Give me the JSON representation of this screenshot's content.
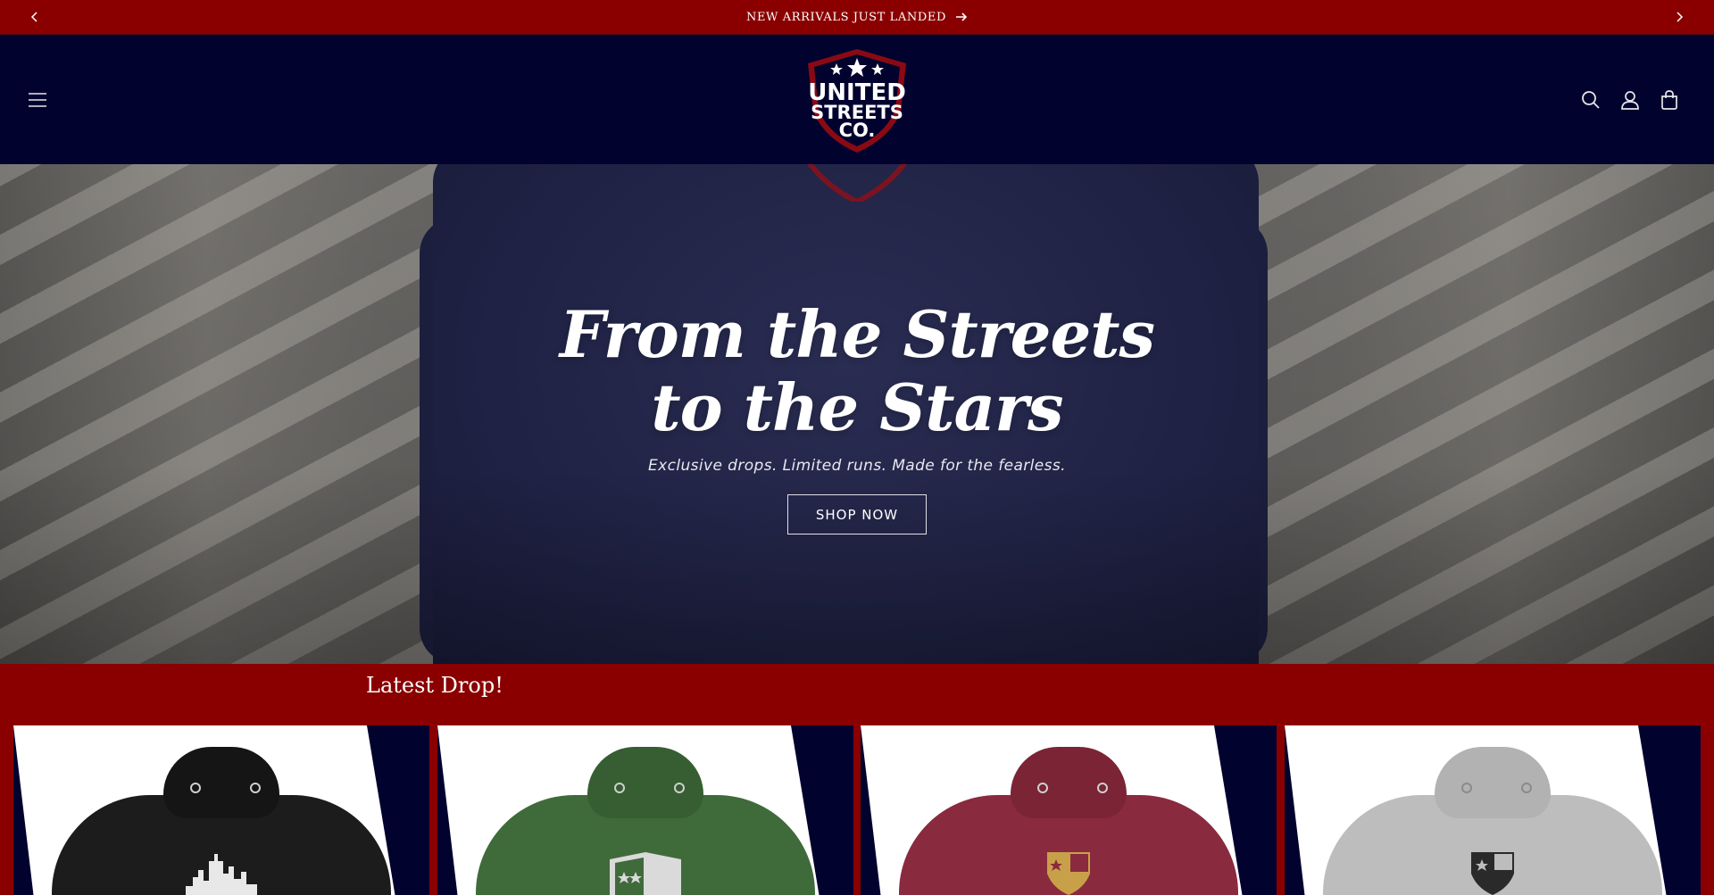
{
  "announcement": {
    "text": "NEW ARRIVALS JUST LANDED",
    "prev_icon": "chevron-left-icon",
    "next_icon": "chevron-right-icon",
    "link_icon": "arrow-right-icon"
  },
  "header": {
    "logo": {
      "line1": "UNITED",
      "line2": "STREETS",
      "line3": "CO."
    },
    "menu_icon": "hamburger-icon",
    "search_icon": "search-icon",
    "account_icon": "user-icon",
    "cart_icon": "cart-icon"
  },
  "hero": {
    "title": "From the Streets to the Stars",
    "subtitle": "Exclusive drops. Limited runs. Made for the fearless.",
    "button_label": "SHOP NOW"
  },
  "latest_drop": {
    "title": "Latest Drop!",
    "products": [
      {
        "color_name": "black",
        "hoodie_color": "#1c1c1c",
        "print": "city-skyline-graphic"
      },
      {
        "color_name": "green",
        "hoodie_color": "#3f6b3a",
        "print": "shield-stars-graphic"
      },
      {
        "color_name": "maroon",
        "hoodie_color": "#8a2a3e",
        "print": "gold-shield-graphic"
      },
      {
        "color_name": "grey",
        "hoodie_color": "#bdbdbd",
        "print": "dark-shield-graphic"
      }
    ]
  },
  "colors": {
    "brand_red": "#8a0000",
    "brand_navy": "#02022e"
  }
}
